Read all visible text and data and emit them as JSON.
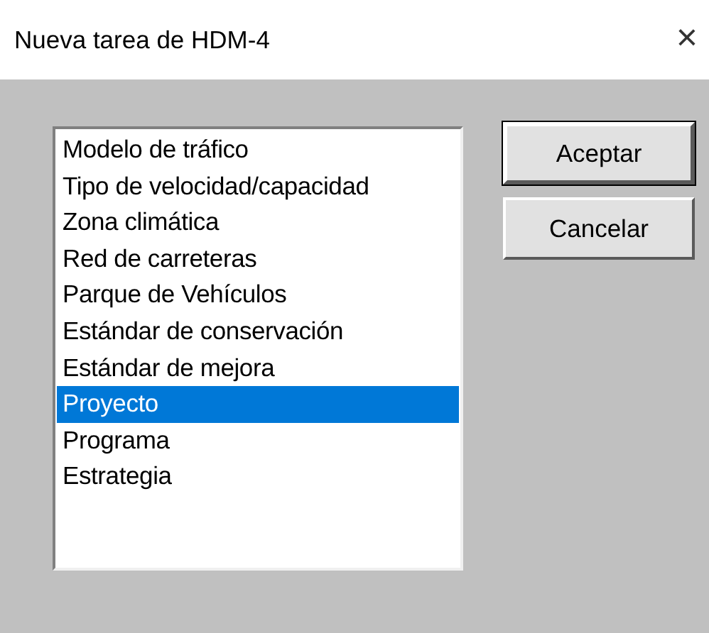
{
  "window": {
    "title": "Nueva tarea de HDM-4",
    "close": "×"
  },
  "list": {
    "items": [
      {
        "label": "Modelo de tráfico",
        "selected": false
      },
      {
        "label": "Tipo de velocidad/capacidad",
        "selected": false
      },
      {
        "label": "Zona climática",
        "selected": false
      },
      {
        "label": "Red de carreteras",
        "selected": false
      },
      {
        "label": "Parque de Vehículos",
        "selected": false
      },
      {
        "label": "Estándar de conservación",
        "selected": false
      },
      {
        "label": "Estándar de mejora",
        "selected": false
      },
      {
        "label": "Proyecto",
        "selected": true
      },
      {
        "label": "Programa",
        "selected": false
      },
      {
        "label": "Estrategia",
        "selected": false
      }
    ]
  },
  "buttons": [
    {
      "label": "Aceptar",
      "default": true
    },
    {
      "label": "Cancelar",
      "default": false
    }
  ]
}
